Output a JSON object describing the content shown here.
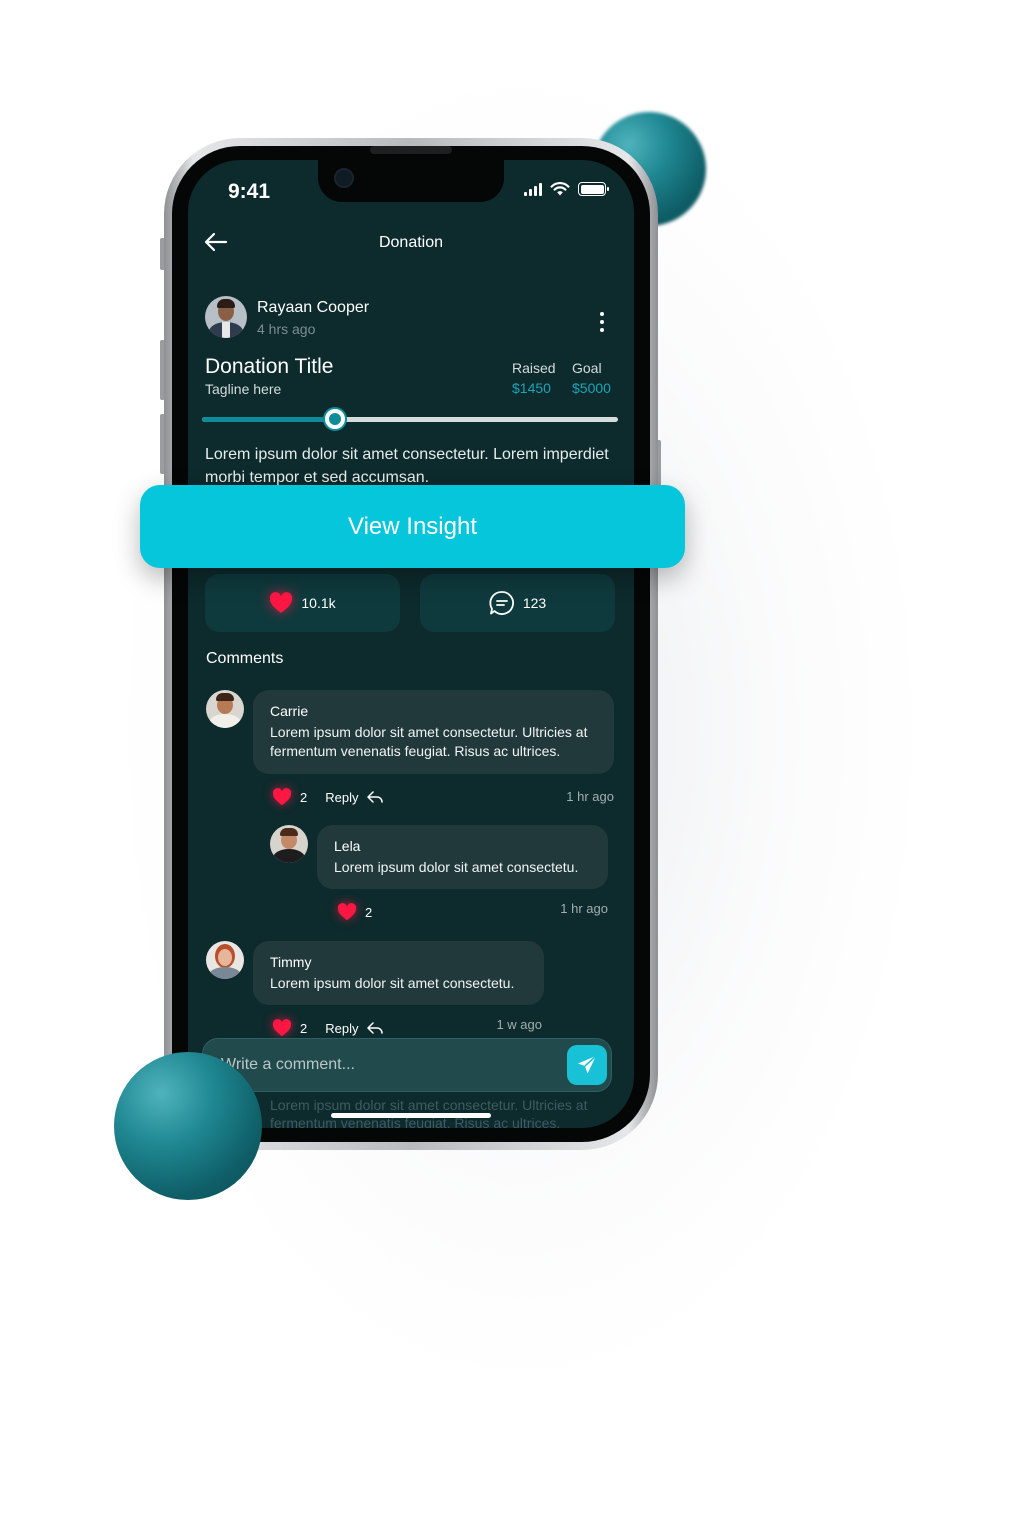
{
  "status_bar": {
    "time": "9:41"
  },
  "header": {
    "title": "Donation"
  },
  "post": {
    "author": "Rayaan Cooper",
    "posted": "4 hrs ago",
    "title": "Donation Title",
    "tagline": "Tagline here",
    "raised_label": "Raised",
    "raised_value": "$1450",
    "goal_label": "Goal",
    "goal_value": "$5000",
    "progress_fraction": 0.32,
    "description": "Lorem ipsum dolor sit amet consectetur. Lorem imperdiet morbi tempor et sed accumsan."
  },
  "cta": {
    "label": "View Insight"
  },
  "stats": {
    "likes": "10.1k",
    "comments": "123"
  },
  "comments_section": {
    "heading": "Comments",
    "comments": [
      {
        "name": "Carrie",
        "text": "Lorem ipsum dolor sit amet consectetur. Ultricies at fermentum venenatis feugiat. Risus ac ultrices.",
        "likes": "2",
        "reply_label": "Reply",
        "time": "1 hr ago"
      },
      {
        "name": "Lela",
        "text": "Lorem ipsum dolor sit amet consectetu.",
        "likes": "2",
        "time": "1 hr ago"
      },
      {
        "name": "Timmy",
        "text": "Lorem ipsum dolor sit amet consectetu.",
        "likes": "2",
        "reply_label": "Reply",
        "time": "1 w ago"
      }
    ]
  },
  "composer": {
    "placeholder": "Write a comment..."
  },
  "background_text": "Lorem ipsum dolor sit amet consectetur. Ultricies at fermentum venenatis feugiat. Risus ac ultrices.",
  "colors": {
    "screen_bg": "#0d2a2c",
    "accent": "#06c6dc",
    "progress": "#0e8c9a",
    "heart": "#ff1744",
    "card": "#0f3a3d",
    "bubble": "#22393b"
  }
}
